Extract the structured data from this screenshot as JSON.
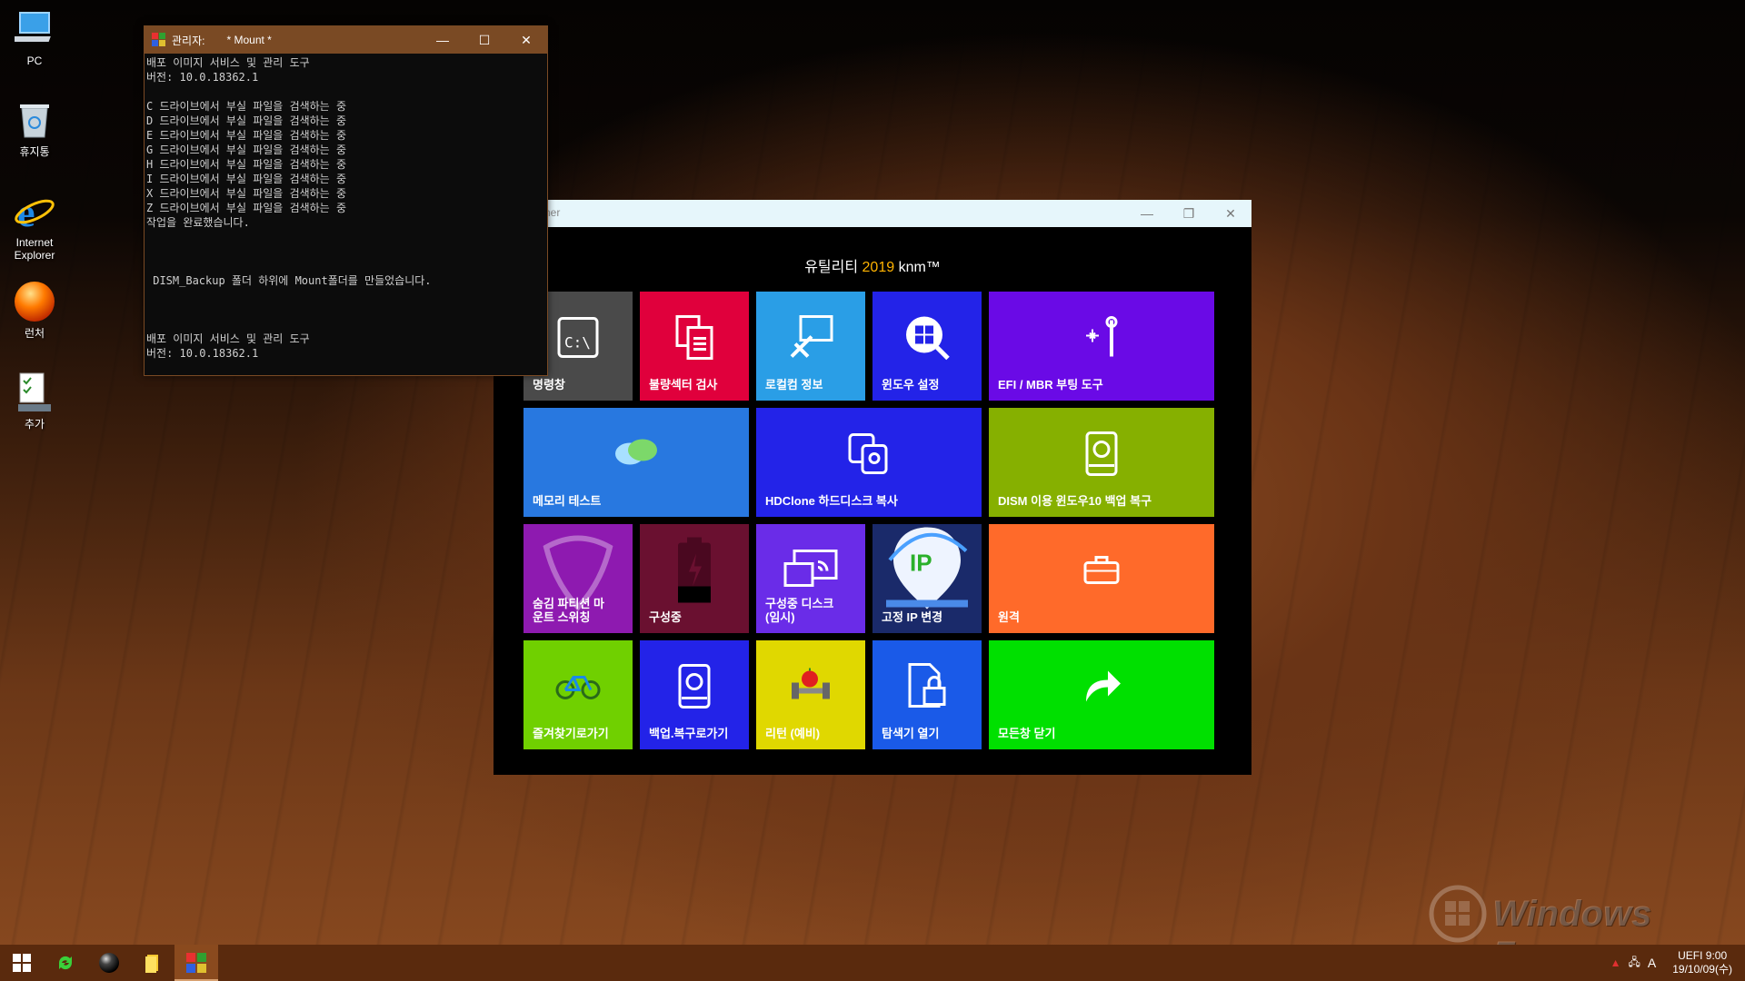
{
  "desktop": {
    "icons": [
      {
        "label": "PC"
      },
      {
        "label": "휴지통"
      },
      {
        "label": "Internet\nExplorer"
      },
      {
        "label": "런처"
      },
      {
        "label": "추가"
      }
    ]
  },
  "console": {
    "title_prefix": "관리자:",
    "title": "* Mount *",
    "lines": "배포 이미지 서비스 및 관리 도구\n버전: 10.0.18362.1\n\nC 드라이브에서 부실 파일을 검색하는 중\nD 드라이브에서 부실 파일을 검색하는 중\nE 드라이브에서 부실 파일을 검색하는 중\nG 드라이브에서 부실 파일을 검색하는 중\nH 드라이브에서 부실 파일을 검색하는 중\nI 드라이브에서 부실 파일을 검색하는 중\nX 드라이브에서 부실 파일을 검색하는 중\nZ 드라이브에서 부실 파일을 검색하는 중\n작업을 완료했습니다.\n\n\n\n DISM_Backup 폴더 하위에 Mount폴더를 만들었습니다.\n\n\n\n배포 이미지 서비스 및 관리 도구\n버전: 10.0.18362.1"
  },
  "launcher": {
    "title_fragment": "ner",
    "heading_prefix": "유틸리티",
    "heading_year": "2019",
    "heading_suffix": "knm™",
    "tiles": [
      {
        "label": "명령창",
        "color": "#4a4a4a"
      },
      {
        "label": "불량섹터 검사",
        "color": "#e0003c"
      },
      {
        "label": "로컬컴 정보",
        "color": "#2a9ee6"
      },
      {
        "label": "윈도우 설정",
        "color": "#2323e8"
      },
      {
        "label": "EFI / MBR 부팅 도구",
        "color": "#6a0ae6"
      },
      {
        "label": "메모리 테스트",
        "color": "#2878e0"
      },
      {
        "label": "HDClone 하드디스크 복사",
        "color": "#2323e8"
      },
      {
        "label": "DISM 이용 윈도우10 백업 복구",
        "color": "#86b000"
      },
      {
        "label": "숨김 파티션 마\n운트 스위칭",
        "color": "#8e1ab0"
      },
      {
        "label": "구성중",
        "color": "#6a1030"
      },
      {
        "label": "구성중 디스크\n(임시)",
        "color": "#6a2ce8"
      },
      {
        "label": "고정 IP 변경",
        "color": "#1a2a6a"
      },
      {
        "label": "원격",
        "color": "#ff6a2a"
      },
      {
        "label": "즐겨찾기로가기",
        "color": "#70d000"
      },
      {
        "label": "백업.복구로가기",
        "color": "#2323e8"
      },
      {
        "label": "리턴 (예비)",
        "color": "#e0d800"
      },
      {
        "label": "탐색기 열기",
        "color": "#1a5ae8"
      },
      {
        "label": "모든창 닫기",
        "color": "#00e000"
      }
    ]
  },
  "watermark": {
    "text": "Windows Forum"
  },
  "taskbar": {
    "clock_line1": "UEFI  9:00",
    "clock_line2": "19/10/09(수)",
    "ime": "A"
  }
}
